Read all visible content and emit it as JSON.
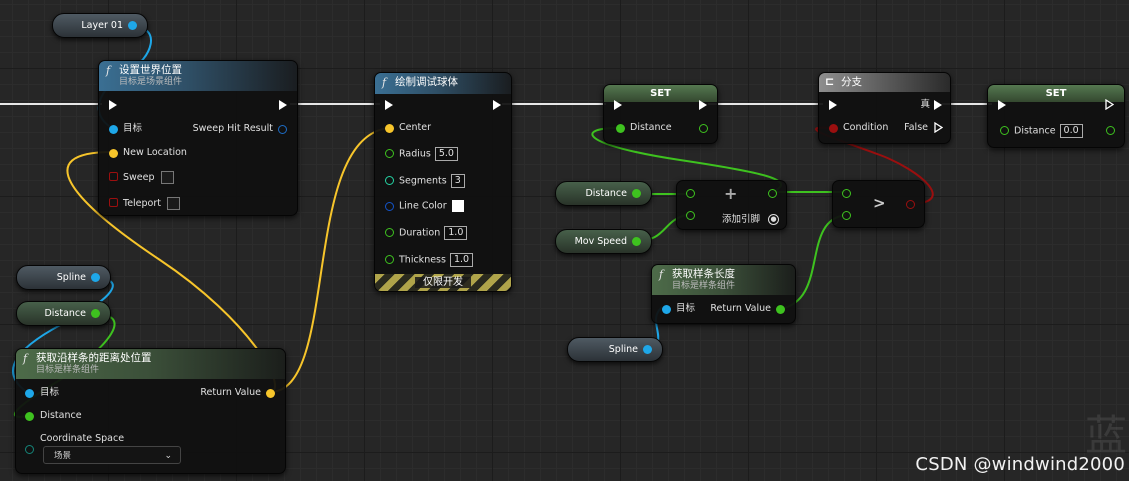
{
  "nodes": {
    "set_world_location": {
      "title": "设置世界位置",
      "subtitle": "目标是场景组件",
      "pins": {
        "target": "目标",
        "new_location": "New Location",
        "sweep": "Sweep",
        "teleport": "Teleport",
        "sweep_hit_result": "Sweep Hit Result"
      }
    },
    "draw_debug_sphere": {
      "title": "绘制调试球体",
      "pins": {
        "center": "Center",
        "radius": "Radius",
        "radius_val": "5.0",
        "segments": "Segments",
        "segments_val": "3",
        "line_color": "Line Color",
        "duration": "Duration",
        "duration_val": "1.0",
        "thickness": "Thickness",
        "thickness_val": "1.0"
      },
      "dev_only": "仅限开发"
    },
    "set_distance_1": {
      "title": "SET",
      "pin": "Distance"
    },
    "branch": {
      "title": "分支",
      "pins": {
        "condition": "Condition",
        "true": "真",
        "false": "False"
      }
    },
    "set_distance_2": {
      "title": "SET",
      "pin": "Distance",
      "value": "0.0"
    },
    "add": {
      "symbol": "+",
      "add_pin": "添加引脚"
    },
    "greater": {
      "symbol": ">"
    },
    "get_spline_length": {
      "title": "获取样条长度",
      "subtitle": "目标是样条组件",
      "pins": {
        "target": "目标",
        "return_value": "Return Value"
      }
    },
    "get_location_at_distance": {
      "title": "获取沿样条的距离处位置",
      "subtitle": "目标是样条组件",
      "pins": {
        "target": "目标",
        "distance": "Distance",
        "coordinate_space": "Coordinate Space",
        "coordinate_space_value": "场景",
        "return_value": "Return Value"
      }
    }
  },
  "variables": {
    "layer": "Layer 01",
    "spline_1": "Spline",
    "distance_1": "Distance",
    "distance_2": "Distance",
    "mov_speed": "Mov Speed",
    "spline_2": "Spline"
  },
  "watermark": "CSDN @windwind2000",
  "ghost_text": "蓝",
  "colors": {
    "exec": "#ffffff",
    "object": "#1ea7e8",
    "float": "#3ec21f",
    "vector": "#f7c52b",
    "bool": "#9b0f0f",
    "color": "#1354c9",
    "int": "#25d4a4",
    "struct": "#1d6dc7"
  }
}
